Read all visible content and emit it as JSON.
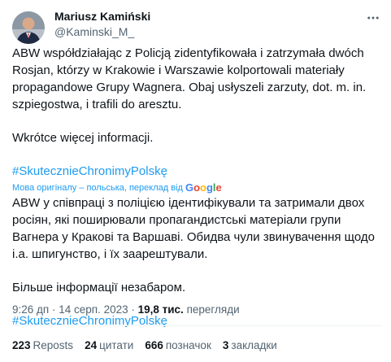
{
  "author": {
    "name": "Mariusz Kamiński",
    "handle": "@Kaminski_M_"
  },
  "original": {
    "paragraph1": "ABW współdziałając z Policją zidentyfikowała i zatrzymała dwóch Rosjan, którzy w Krakowie i Warszawie kolportowali materiały propagandowe Grupy Wagnera. Obaj usłyszeli zarzuty, dot. m. in. szpiegostwa, i trafili do aresztu.",
    "paragraph2": "Wkrótce więcej informacji.",
    "hashtag": "#SkutecznieChronimyPolskę"
  },
  "translation_note": {
    "text": "Мова оригіналу – польська, переклад від",
    "provider": "Google"
  },
  "translated": {
    "paragraph1": "ABW у співпраці з поліцією ідентифікували та затримали двох росіян, які поширювали пропагандистські матеріали групи Вагнера у Кракові та Варшаві. Обидва чули звинувачення щодо і.а. шпигунство, і їх заарештували.",
    "paragraph2": "Більше інформації незабаром.",
    "hashtag": "#SkutecznieChronimyPolskę"
  },
  "meta": {
    "time": "9:26 дп",
    "sep1": " · ",
    "date": "14 серп. 2023",
    "sep2": " · ",
    "views_count": "19,8 тис.",
    "views_label": " перегляди"
  },
  "stats": {
    "reposts_count": "223",
    "reposts_label": "Reposts",
    "quotes_count": "24",
    "quotes_label": "цитати",
    "likes_count": "666",
    "likes_label": "позначок",
    "bookmarks_count": "3",
    "bookmarks_label": "закладки"
  },
  "colors": {
    "link": "#1d9bf0",
    "secondary": "#536471",
    "primary": "#0f1419"
  },
  "icons": {
    "avatar": "profile-photo",
    "more": "more-horizontal-icon"
  }
}
